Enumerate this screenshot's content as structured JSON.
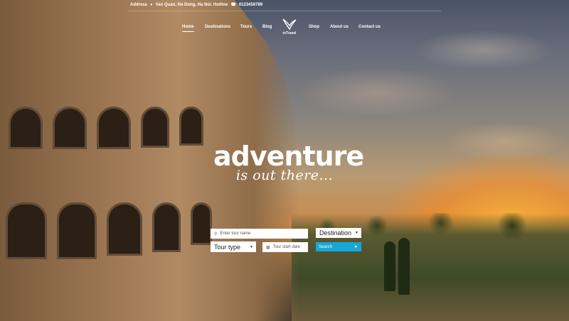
{
  "topbar": {
    "address_label": "Address",
    "address_value": "Van Quan, Ha Dong, Ha Noi. Hotline",
    "hotline": "0123456789"
  },
  "nav": {
    "items": [
      {
        "label": "Home",
        "active": true
      },
      {
        "label": "Destinations",
        "active": false
      },
      {
        "label": "Tours",
        "active": false
      },
      {
        "label": "Blog",
        "active": false
      },
      {
        "label": "Shop",
        "active": false
      },
      {
        "label": "About us",
        "active": false
      },
      {
        "label": "Contact us",
        "active": false
      }
    ],
    "logo_text": "inTravel"
  },
  "hero": {
    "title": "adventure",
    "subtitle": "is out there..."
  },
  "search_form": {
    "tour_name_placeholder": "Enter tour name",
    "destination_selected": "Destination",
    "tour_type_selected": "Tour type",
    "start_date_placeholder": "Tour start date",
    "search_label": "Search"
  },
  "colors": {
    "accent": "#17a8d8",
    "text": "#ffffff"
  },
  "icons": [
    "location-pin-icon",
    "phone-icon",
    "search-icon",
    "calendar-icon",
    "chevron-down-icon",
    "paper-plane-icon"
  ]
}
